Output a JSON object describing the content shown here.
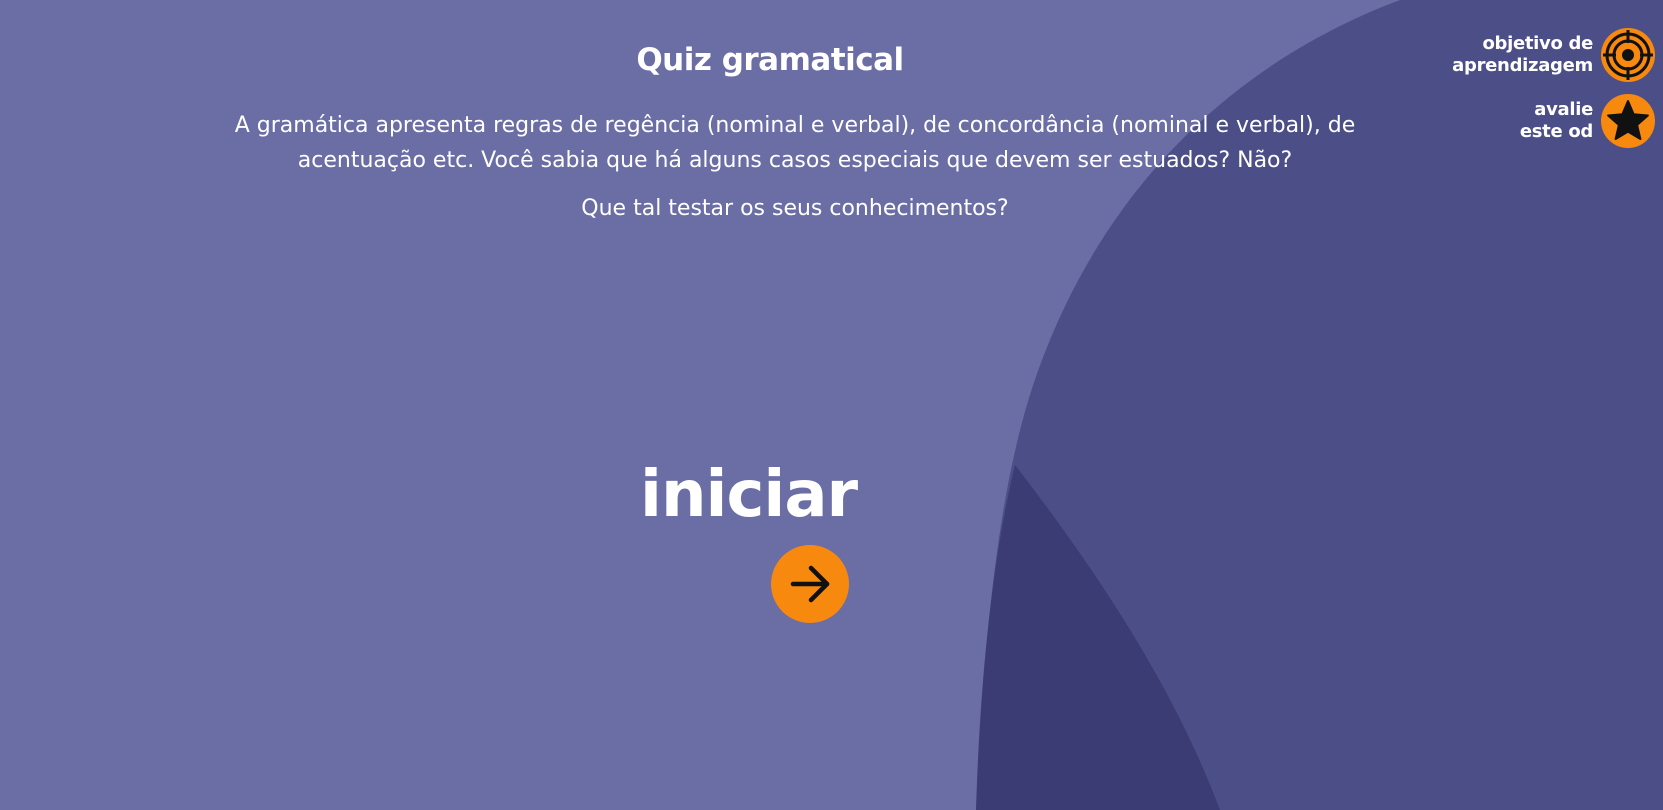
{
  "header": {
    "title": "Quiz gramatical"
  },
  "intro": {
    "paragraph": "A gramática apresenta regras de regência (nominal e verbal), de concordância (nominal e verbal), de acentuação etc. Você sabia que há alguns casos especiais que devem ser estuados? Não?",
    "question": "Que tal testar os seus conhecimentos?"
  },
  "start": {
    "label": "iniciar",
    "icon": "arrow-right-icon"
  },
  "side_links": {
    "objective": {
      "line1": "objetivo de",
      "line2": "aprendizagem",
      "icon": "target-icon"
    },
    "rate": {
      "line1": "avalie",
      "line2": "este od",
      "icon": "star-icon"
    }
  },
  "colors": {
    "background": "#6b6da5",
    "shape_mid": "#4c4f87",
    "shape_dark": "#3b3c74",
    "accent": "#f7890e",
    "text": "#ffffff"
  }
}
